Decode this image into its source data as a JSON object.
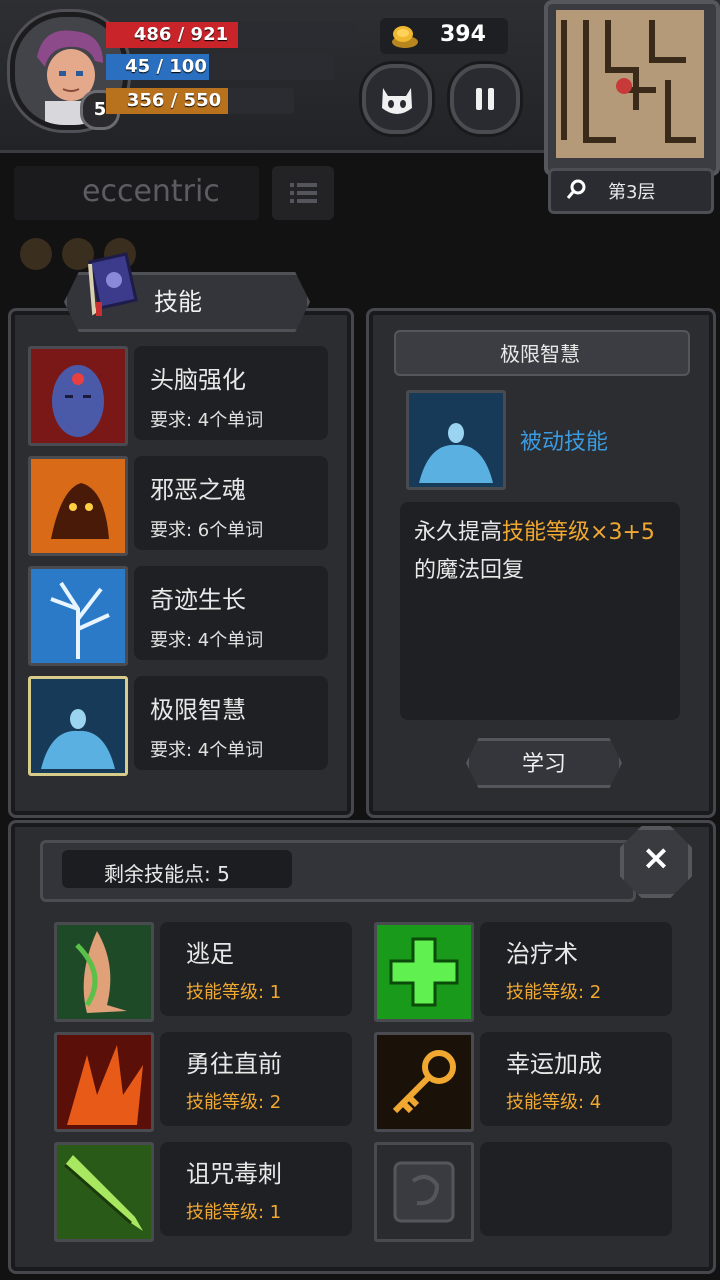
{
  "hud": {
    "hp": "486 / 921",
    "hp_fraction": 0.528,
    "mp": "45 / 100",
    "mp_fraction": 0.45,
    "xp": "356 / 550",
    "xp_fraction": 0.647,
    "level": "5",
    "gold": "394",
    "floor": "第3层",
    "current_word": "eccentric"
  },
  "skills_panel": {
    "tab_title": "技能",
    "items": [
      {
        "name": "头脑强化",
        "requirement": "要求: 4个单词"
      },
      {
        "name": "邪恶之魂",
        "requirement": "要求: 6个单词"
      },
      {
        "name": "奇迹生长",
        "requirement": "要求: 4个单词"
      },
      {
        "name": "极限智慧",
        "requirement": "要求: 4个单词"
      }
    ]
  },
  "detail": {
    "title": "极限智慧",
    "type_label": "被动技能",
    "desc_part1": "永久提高",
    "desc_highlight": "技能等级×3+5",
    "desc_part2": "的魔法回复",
    "learn_label": "学习"
  },
  "owned": {
    "points_label": "剩余技能点: 5",
    "items": [
      {
        "name": "逃足",
        "level": "技能等级: 1"
      },
      {
        "name": "治疗术",
        "level": "技能等级: 2"
      },
      {
        "name": "勇往直前",
        "level": "技能等级: 2"
      },
      {
        "name": "幸运加成",
        "level": "技能等级: 4"
      },
      {
        "name": "诅咒毒刺",
        "level": "技能等级: 1"
      }
    ]
  },
  "colors": {
    "hp": "#c8242a",
    "mp": "#2a6fc0",
    "xp": "#b8721e",
    "accent": "#f0a830",
    "passive": "#3a9be0"
  }
}
